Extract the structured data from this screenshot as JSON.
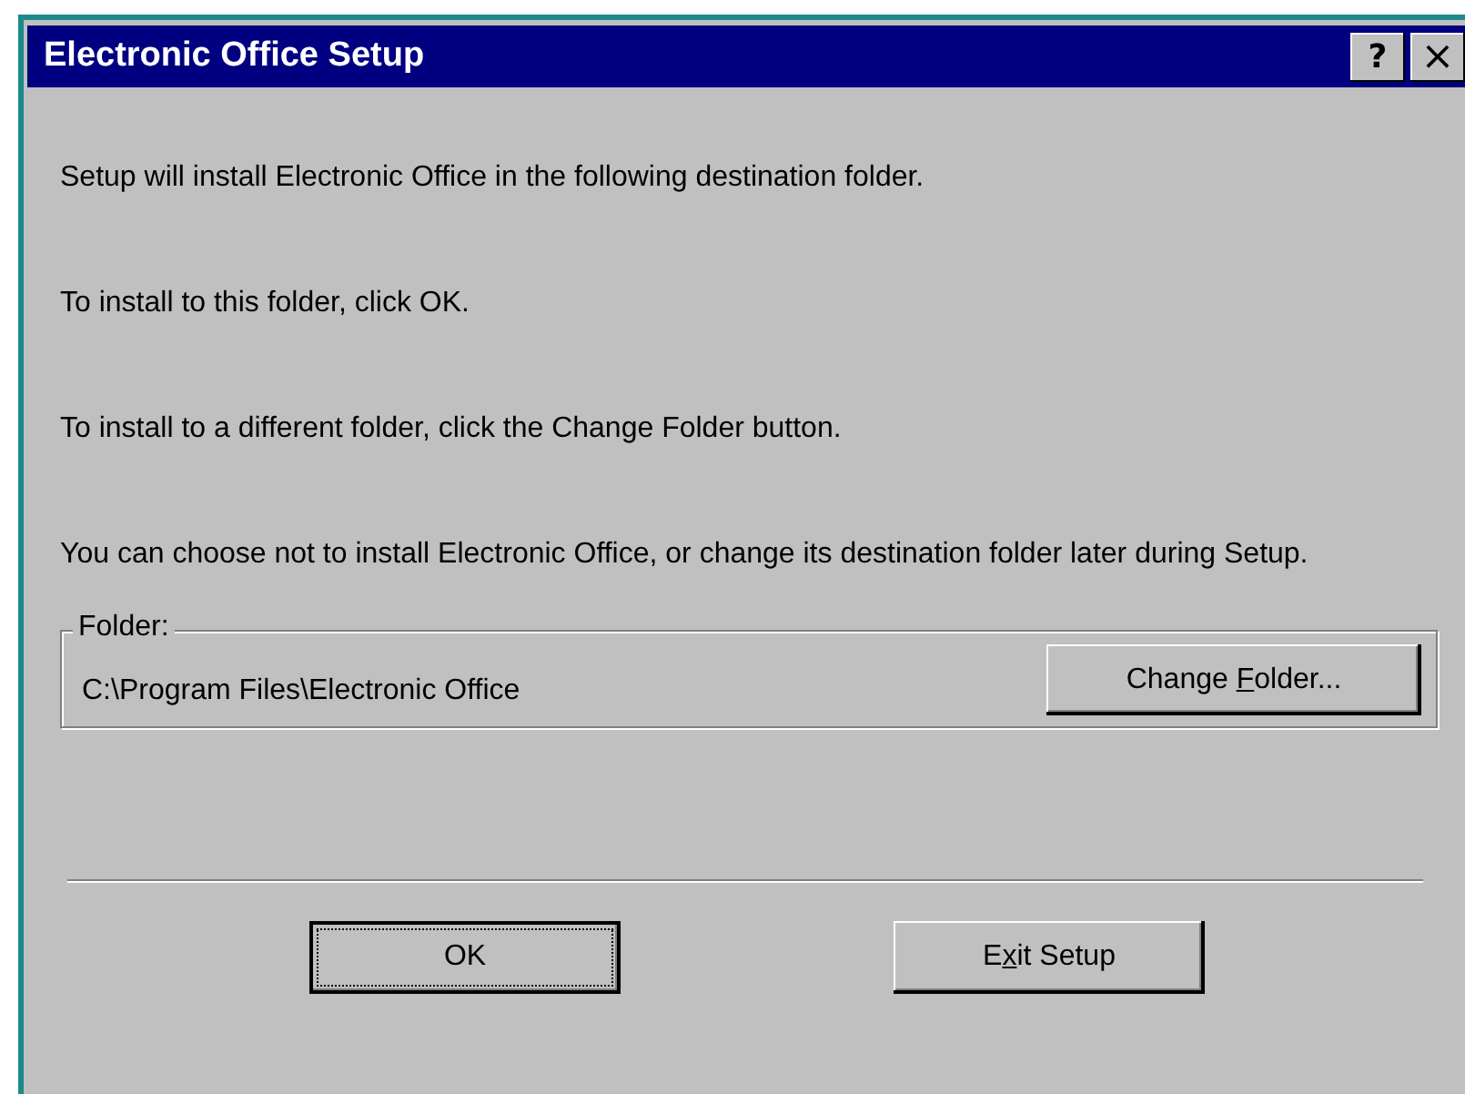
{
  "window": {
    "title": "Electronic Office Setup",
    "title_buttons": [
      {
        "kind": "help",
        "label": "?"
      },
      {
        "kind": "close",
        "label": "×"
      }
    ]
  },
  "messages": [
    "Setup will install Electronic Office in the following destination folder.",
    "To install to this folder, click OK.",
    "To install to a different folder, click the Change Folder button.",
    "You can choose not to install Electronic Office, or change its destination folder later during Setup."
  ],
  "folder_group": {
    "label": "Folder:",
    "path": "C:\\Program Files\\Electronic Office",
    "button": {
      "before": "Change ",
      "access_key": "F",
      "after": "older..."
    }
  },
  "buttons": [
    {
      "after": "OK",
      "default": true
    },
    {
      "before": "E",
      "access_key": "x",
      "after": "it Setup",
      "default": false
    }
  ]
}
